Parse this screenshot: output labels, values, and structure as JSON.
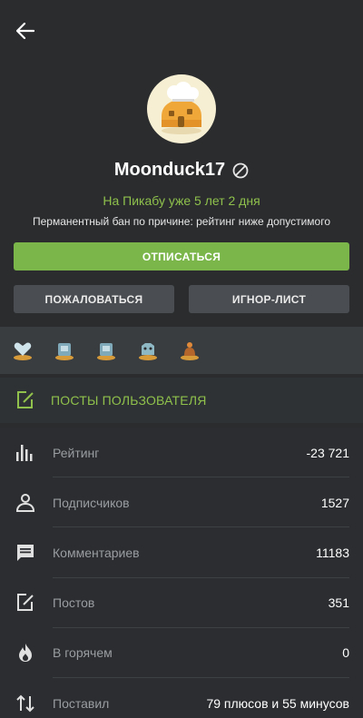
{
  "profile": {
    "username": "Moonduck17",
    "on_site": "На Пикабу уже 5 лет 2 дня",
    "ban_reason": "Перманентный бан по причине: рейтинг ниже допустимого"
  },
  "buttons": {
    "unsubscribe": "ОТПИСАТЬСЯ",
    "report": "ПОЖАЛОВАТЬСЯ",
    "ignore": "ИГНОР-ЛИСТ"
  },
  "posts_section": {
    "label": "ПОСТЫ ПОЛЬЗОВАТЕЛЯ"
  },
  "stats": [
    {
      "label": "Рейтинг",
      "value": "-23 721",
      "icon": "bar-chart-icon"
    },
    {
      "label": "Подписчиков",
      "value": "1527",
      "icon": "person-icon"
    },
    {
      "label": "Комментариев",
      "value": "11183",
      "icon": "comment-icon"
    },
    {
      "label": "Постов",
      "value": "351",
      "icon": "edit-icon"
    },
    {
      "label": "В горячем",
      "value": "0",
      "icon": "flame-icon"
    },
    {
      "label": "Поставил",
      "value": "79 плюсов и 55 минусов",
      "icon": "sort-arrows-icon"
    }
  ],
  "colors": {
    "background": "#2a2c2e",
    "accent_green": "#7ab64a",
    "text_green": "#8fc14c",
    "button_gray": "#4a4d51"
  }
}
